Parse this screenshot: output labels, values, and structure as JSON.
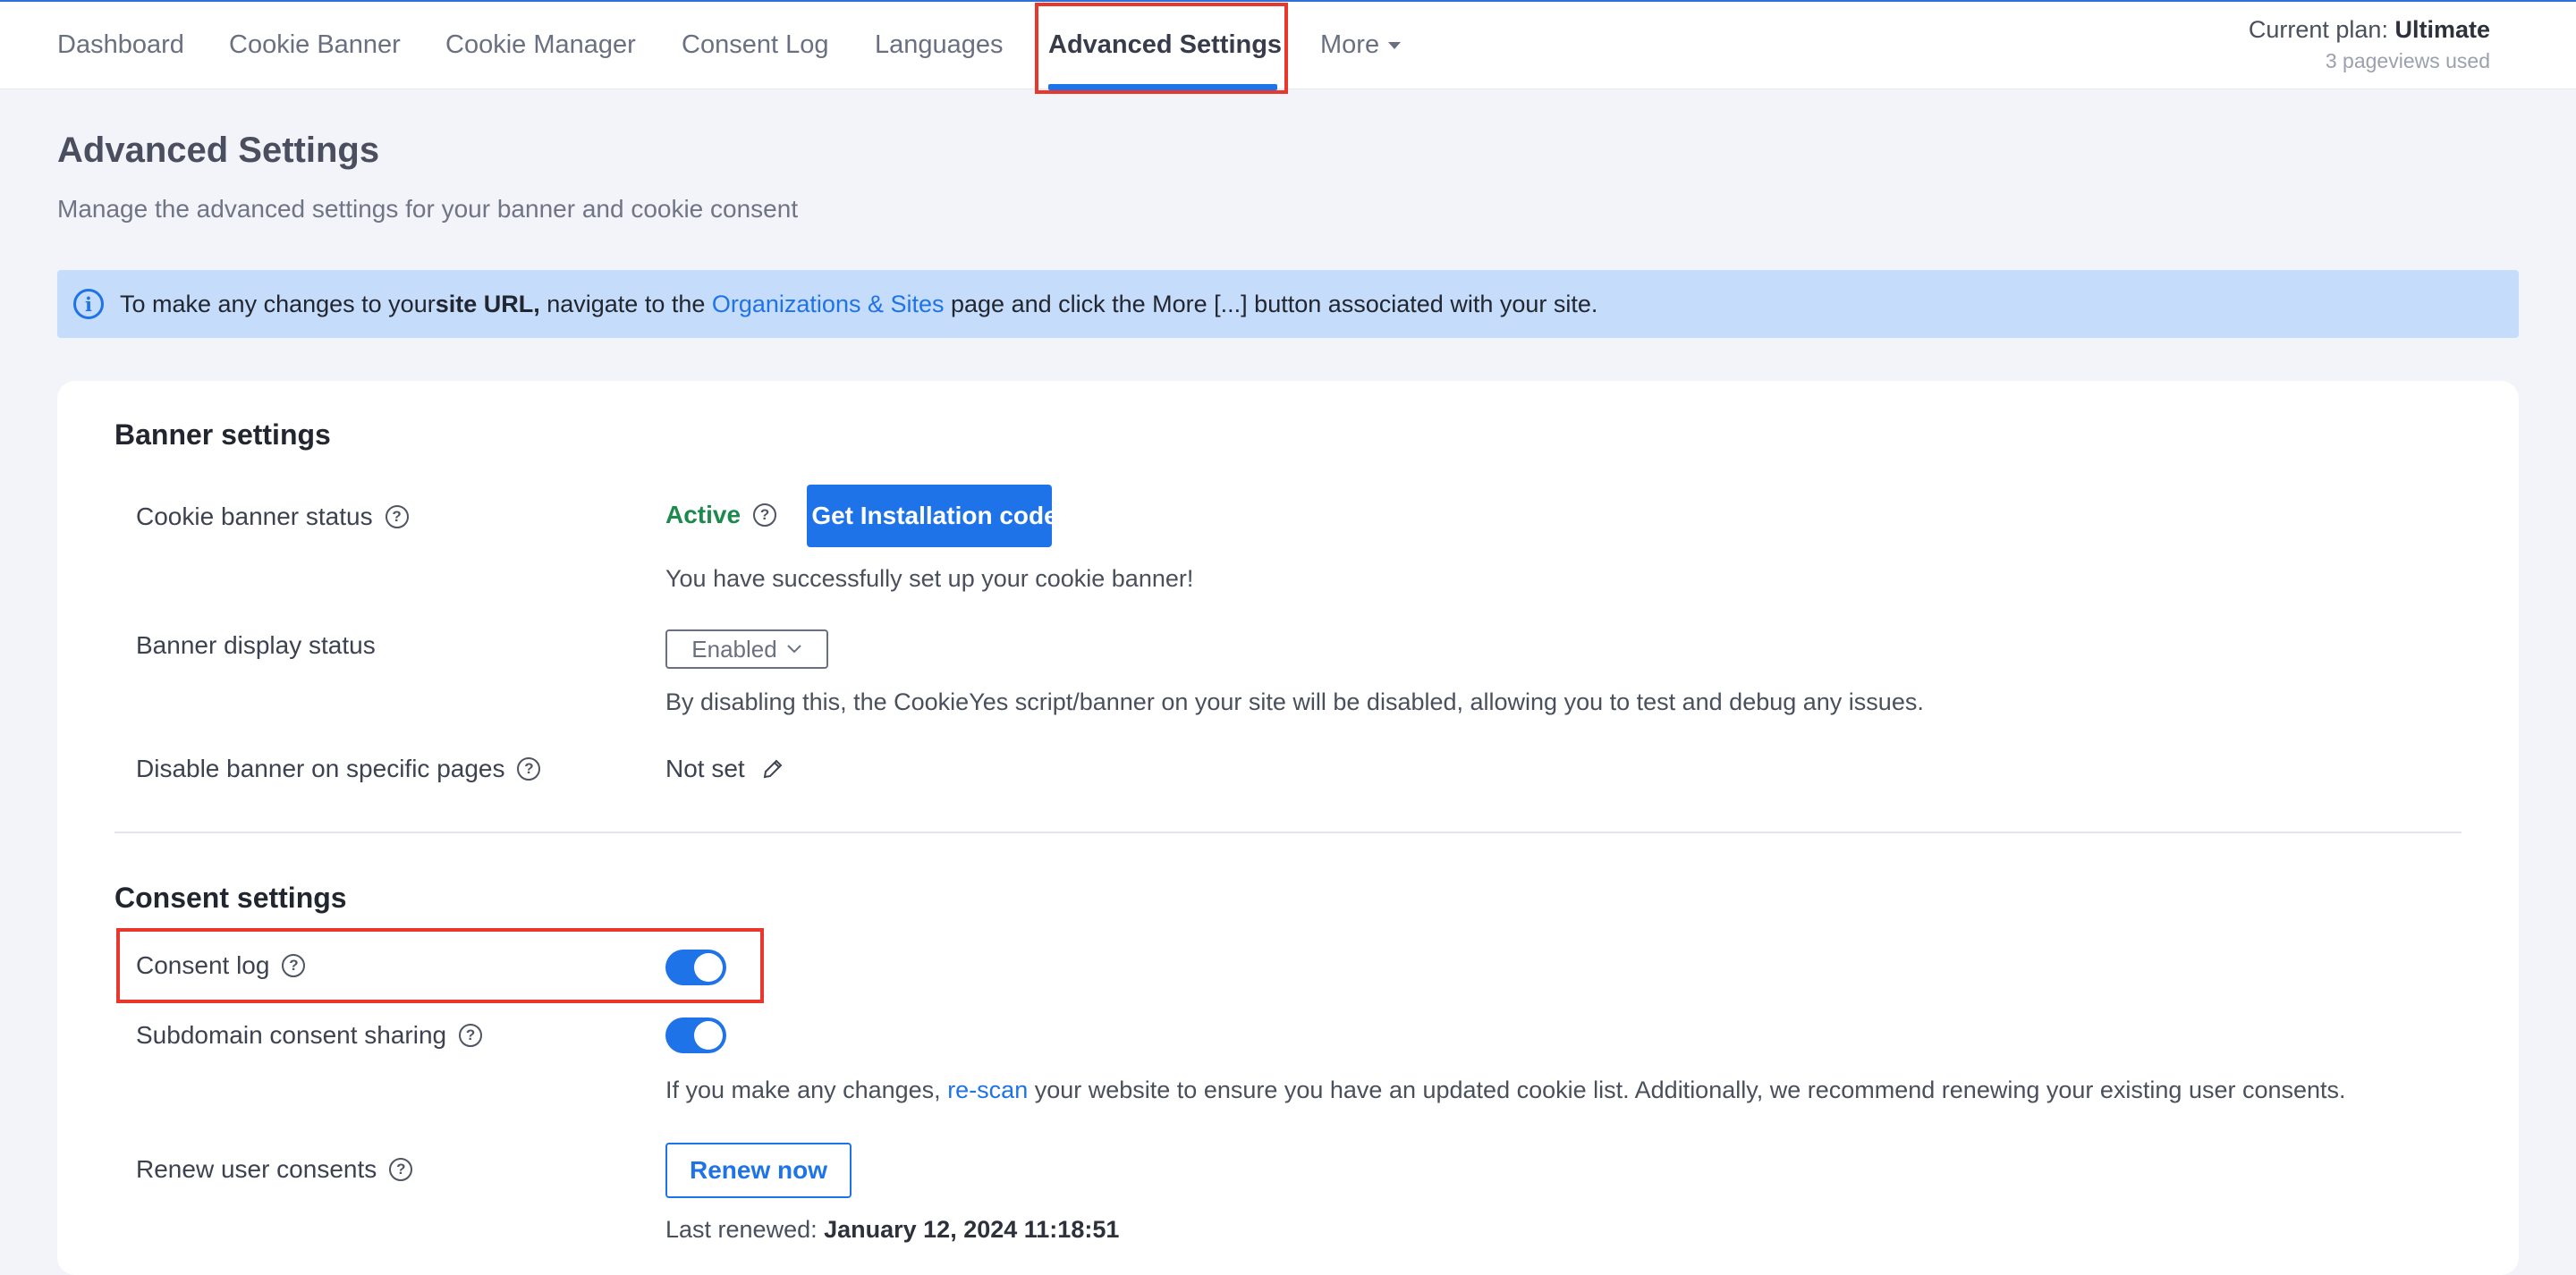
{
  "nav": {
    "items": [
      "Dashboard",
      "Cookie Banner",
      "Cookie Manager",
      "Consent Log",
      "Languages",
      "Advanced Settings"
    ],
    "more_label": "More",
    "active": "Advanced Settings"
  },
  "plan": {
    "label": "Current plan:",
    "name": "Ultimate",
    "usage": "3 pageviews used"
  },
  "page": {
    "title": "Advanced Settings",
    "subtitle": "Manage the advanced settings for your banner and cookie consent"
  },
  "info": {
    "part1": "To make any changes to your ",
    "bold": "site URL,",
    "part2": " navigate to the ",
    "link": "Organizations & Sites",
    "part3": " page and click the More [...] button associated with your site."
  },
  "banner_settings": {
    "title": "Banner settings",
    "status_label": "Cookie banner status",
    "status_value": "Active",
    "install_button": "Get Installation code",
    "status_desc": "You have successfully set up your cookie banner!",
    "display_label": "Banner display status",
    "display_value": "Enabled",
    "display_desc": "By disabling this, the CookieYes script/banner on your site will be disabled, allowing you to test and debug any issues.",
    "disable_pages_label": "Disable banner on specific pages",
    "disable_pages_value": "Not set"
  },
  "consent_settings": {
    "title": "Consent settings",
    "consent_log_label": "Consent log",
    "consent_log_on": true,
    "subdomain_label": "Subdomain consent sharing",
    "subdomain_on": true,
    "rescan_part1": "If you make any changes, ",
    "rescan_link": "re-scan",
    "rescan_part2": " your website to ensure you have an updated cookie list. Additionally, we recommend renewing your existing user consents.",
    "renew_label": "Renew user consents",
    "renew_button": "Renew now",
    "last_renewed_label": "Last renewed: ",
    "last_renewed_value": "January 12, 2024 11:18:51"
  },
  "colors": {
    "accent": "#1f73e8",
    "active_green": "#1c8a4c",
    "highlight_red": "#e8372c",
    "info_bg": "#c5dcfa"
  }
}
